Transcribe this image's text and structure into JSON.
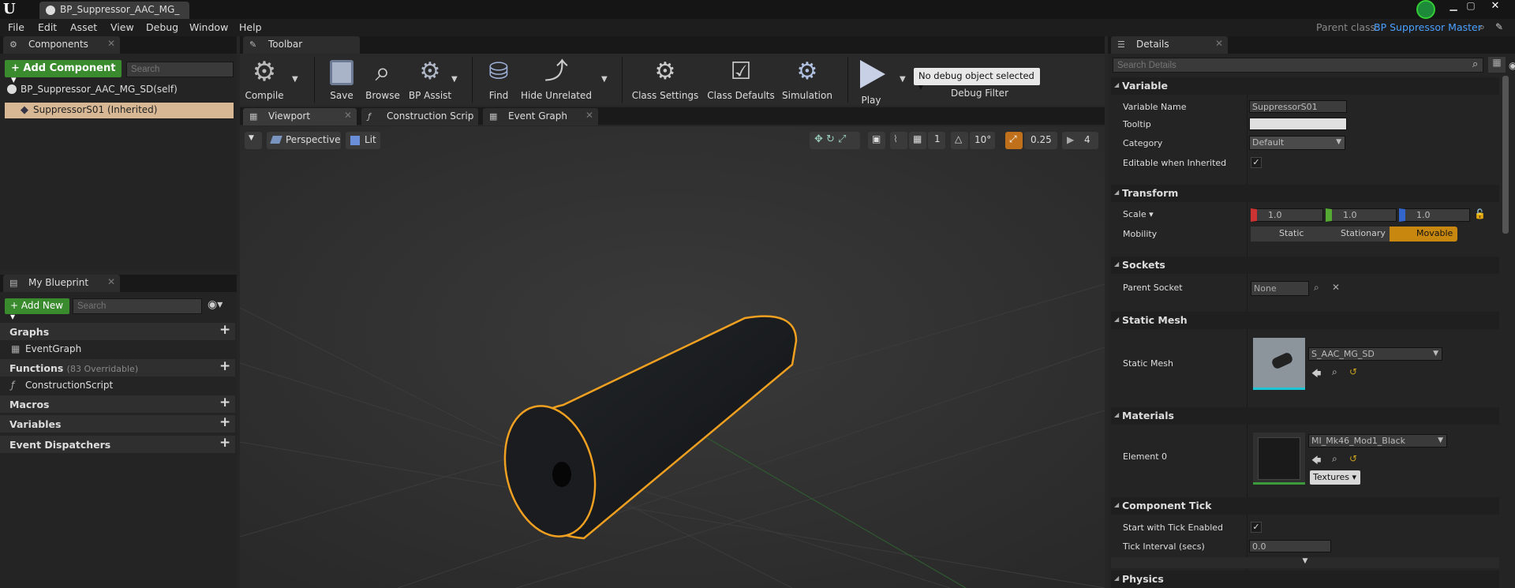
{
  "window": {
    "doc_tab": "BP_Suppressor_AAC_MG_",
    "parent_class_label": "Parent class:",
    "parent_class_value": "BP Suppressor Master"
  },
  "menu": [
    "File",
    "Edit",
    "Asset",
    "View",
    "Debug",
    "Window",
    "Help"
  ],
  "components": {
    "tab": "Components",
    "add_label": "+ Add Component ▾",
    "search_placeholder": "Search",
    "items": [
      "BP_Suppressor_AAC_MG_SD(self)",
      "SuppressorS01 (Inherited)"
    ]
  },
  "my_blueprint": {
    "tab": "My Blueprint",
    "add_label": "+ Add New ▾",
    "search_placeholder": "Search",
    "graphs": "Graphs",
    "event_graph": "EventGraph",
    "functions": "Functions",
    "overridable": "(83 Overridable)",
    "construction": "ConstructionScript",
    "macros": "Macros",
    "variables": "Variables",
    "dispatchers": "Event Dispatchers"
  },
  "toolbar": {
    "tab": "Toolbar",
    "buttons": [
      "Compile",
      "Save",
      "Browse",
      "BP Assist",
      "Find",
      "Hide Unrelated",
      "Class Settings",
      "Class Defaults",
      "Simulation",
      "Play"
    ],
    "debug_select": "No debug object selected ▾",
    "debug_filter": "Debug Filter"
  },
  "editor_tabs": [
    "Viewport",
    "Construction Scrip",
    "Event Graph"
  ],
  "viewport": {
    "perspective": "Perspective",
    "lit": "Lit",
    "angle": "10°",
    "scale_snap": "0.25",
    "speed": "4"
  },
  "details": {
    "tab": "Details",
    "search_placeholder": "Search Details",
    "variable": {
      "header": "Variable",
      "name_label": "Variable Name",
      "name_value": "SuppressorS01",
      "tooltip_label": "Tooltip",
      "category_label": "Category",
      "category_value": "Default",
      "editable_label": "Editable when Inherited"
    },
    "transform": {
      "header": "Transform",
      "scale_label": "Scale ▾",
      "x": "1.0",
      "y": "1.0",
      "z": "1.0",
      "mobility_label": "Mobility",
      "mobility": [
        "Static",
        "Stationary",
        "Movable"
      ]
    },
    "sockets": {
      "header": "Sockets",
      "parent_label": "Parent Socket",
      "parent_value": "None"
    },
    "static_mesh": {
      "header": "Static Mesh",
      "label": "Static Mesh",
      "value": "S_AAC_MG_SD"
    },
    "materials": {
      "header": "Materials",
      "label": "Element 0",
      "value": "MI_Mk46_Mod1_Black",
      "textures": "Textures ▾"
    },
    "tick": {
      "header": "Component Tick",
      "start_label": "Start with Tick Enabled",
      "interval_label": "Tick Interval (secs)",
      "interval_value": "0.0"
    },
    "physics": {
      "header": "Physics"
    }
  },
  "colors": {
    "accent_orange": "#f0a020",
    "add_green": "#3a8a2e",
    "link_blue": "#4aa0ff",
    "selected_row": "#d8b894"
  }
}
